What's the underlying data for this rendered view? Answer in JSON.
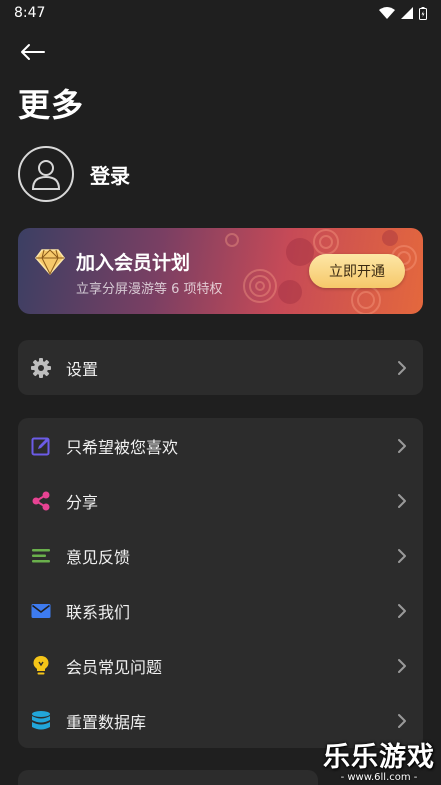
{
  "status_bar": {
    "time": "8:47"
  },
  "page": {
    "title": "更多"
  },
  "profile": {
    "login_label": "登录"
  },
  "vip": {
    "title": "加入会员计划",
    "subtitle": "立享分屏漫游等 6 项特权",
    "button_label": "立即开通"
  },
  "settings_card": {
    "items": [
      {
        "label": "设置",
        "icon": "gear-icon"
      }
    ]
  },
  "menu": {
    "items": [
      {
        "label": "只希望被您喜欢",
        "icon": "edit-icon",
        "color": "#6c5ce7"
      },
      {
        "label": "分享",
        "icon": "share-icon",
        "color": "#e84393"
      },
      {
        "label": "意见反馈",
        "icon": "feedback-lines-icon",
        "color": "#6ab04c"
      },
      {
        "label": "联系我们",
        "icon": "mail-icon",
        "color": "#3d7bf0"
      },
      {
        "label": "会员常见问题",
        "icon": "lightbulb-icon",
        "color": "#f5c518"
      },
      {
        "label": "重置数据库",
        "icon": "database-icon",
        "color": "#22a6d9"
      }
    ]
  },
  "watermark": {
    "title": "乐乐游戏",
    "url": "- www.6ll.com -"
  }
}
